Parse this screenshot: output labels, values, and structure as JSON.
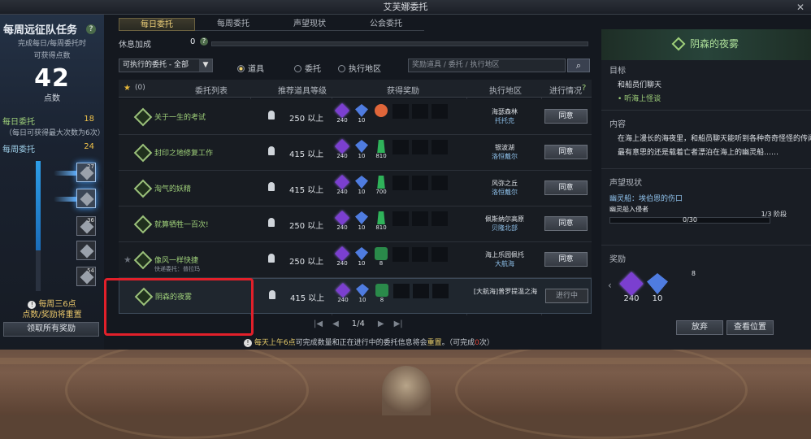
{
  "window": {
    "title": "艾芙娜委托",
    "close": "✕"
  },
  "left": {
    "title": "每周远征队任务",
    "help": "?",
    "sub1": "完成每日/每周委托时",
    "sub2": "可获得点数",
    "points": "42",
    "unit": "点数",
    "daily_label": "每日委托",
    "daily_value": "18",
    "daily_note": "（每日可获得最大次数为6次）",
    "weekly_label": "每周委托",
    "weekly_value": "24",
    "slots": [
      "27",
      "",
      "36",
      "",
      "54"
    ],
    "reset_note1": "每周三6点",
    "reset_note2": "点数/奖励将重置",
    "claim": "领取所有奖励"
  },
  "tabs": [
    "每日委托",
    "每周委托",
    "声望现状",
    "公会委托"
  ],
  "rest": {
    "label": "休息加成",
    "value": "0"
  },
  "filter": {
    "value": "可执行的委托 - 全部",
    "arrow": "▼"
  },
  "radios": [
    "道具",
    "委托",
    "执行地区"
  ],
  "search": {
    "placeholder": "奖励道具 / 委托 / 执行地区"
  },
  "table": {
    "star_count": "(0)",
    "headers": [
      "委托列表",
      "推荐道具等级",
      "获得奖励",
      "执行地区",
      "进行情况"
    ],
    "rows": [
      {
        "name": "关于一生的考试",
        "sub": "",
        "level": "250 以上",
        "rewards": [
          "240",
          "10",
          ""
        ],
        "loc1": "海瑟森林",
        "loc2": "托托克",
        "action": "同意"
      },
      {
        "name": "封印之地修复工作",
        "sub": "",
        "level": "415 以上",
        "rewards": [
          "240",
          "10",
          "810"
        ],
        "loc1": "银波湖",
        "loc2": "洛恒戴尔",
        "action": "同意"
      },
      {
        "name": "淘气的妖精",
        "sub": "",
        "level": "415 以上",
        "rewards": [
          "240",
          "10",
          "700"
        ],
        "loc1": "风弥之丘",
        "loc2": "洛恒戴尔",
        "action": "同意"
      },
      {
        "name": "就算牺牲一百次!",
        "sub": "",
        "level": "250 以上",
        "rewards": [
          "240",
          "10",
          "810"
        ],
        "loc1": "佩斯纳尔高原",
        "loc2": "贝隆北部",
        "action": "同意"
      },
      {
        "name": "像风一样快捷",
        "sub": "快递委托：普拉玛",
        "level": "250 以上",
        "rewards": [
          "240",
          "10",
          "8"
        ],
        "loc1": "海上乐园佩托",
        "loc2": "大航海",
        "action": "同意"
      },
      {
        "name": "阴森的夜雾",
        "sub": "",
        "level": "415 以上",
        "rewards": [
          "240",
          "10",
          "8"
        ],
        "loc1": "[大航海]普罗提温之海",
        "loc2": "",
        "action": "进行中"
      }
    ]
  },
  "pager": {
    "first": "|◀",
    "prev": "◀",
    "page": "1/4",
    "next": "▶",
    "last": "▶|"
  },
  "footer": {
    "pre": "每天上午6点",
    "mid": "可完成数量和正在进行中的委托信息将会",
    "reset": "重置",
    "post": "。（可完成",
    "n": "0",
    "tail": "次）"
  },
  "right": {
    "title": "阴森的夜雾",
    "goal_label": "目标",
    "goal": "和船员们聊天",
    "goal_item": "• 听海上怪谈",
    "content_label": "内容",
    "content1": "在海上漫长的海夜里，和船员聊天能听到各种奇奇怪怪的传闻。其",
    "content2": "最有意思的还是载着亡者漂泊在海上的幽灵船……",
    "rep_label": "声望现状",
    "rep_name": "幽灵船：埃伯恩的伤口",
    "rep_level": "幽灵船入侵者",
    "rep_progress": "0/30",
    "rep_stage": "1/3 阶段",
    "reward_label": "奖励",
    "rewards": [
      "240",
      "10",
      "8"
    ],
    "give_up": "放弃",
    "locate": "查看位置"
  }
}
